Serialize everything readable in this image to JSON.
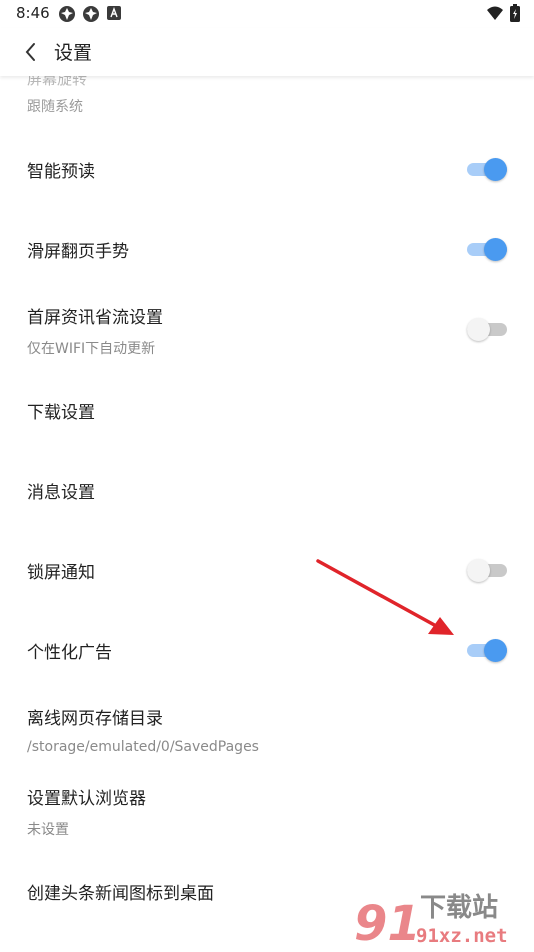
{
  "status_bar": {
    "time": "8:46",
    "left_icons": [
      "notification-icon",
      "notification-icon",
      "app-a-icon"
    ],
    "right_icons": [
      "wifi-icon",
      "battery-icon"
    ]
  },
  "header": {
    "title": "设置",
    "back_icon": "back-chevron-icon"
  },
  "settings": {
    "partial_item": {
      "title": "屏幕旋转",
      "subtitle": "跟随系统"
    },
    "items": [
      {
        "title": "智能预读",
        "toggle": "on"
      },
      {
        "title": "滑屏翻页手势",
        "toggle": "on"
      },
      {
        "title": "首屏资讯省流设置",
        "subtitle": "仅在WIFI下自动更新",
        "toggle": "off"
      },
      {
        "title": "下载设置"
      },
      {
        "title": "消息设置"
      },
      {
        "title": "锁屏通知",
        "toggle": "off"
      },
      {
        "title": "个性化广告",
        "toggle": "on"
      },
      {
        "title": "离线网页存储目录",
        "subtitle": "/storage/emulated/0/SavedPages"
      },
      {
        "title": "设置默认浏览器",
        "subtitle": "未设置"
      },
      {
        "title": "创建头条新闻图标到桌面"
      }
    ]
  },
  "watermark": {
    "name": "下载站",
    "domain": "91xz.net",
    "logo": "91"
  },
  "colors": {
    "accent": "#4a9af0",
    "accent_track": "#a8cdf8",
    "toggle_off_thumb": "#f4f4f4",
    "toggle_off_track": "#c9c9c9",
    "annotation_arrow": "#e0242a",
    "watermark_red": "#d8232a"
  }
}
